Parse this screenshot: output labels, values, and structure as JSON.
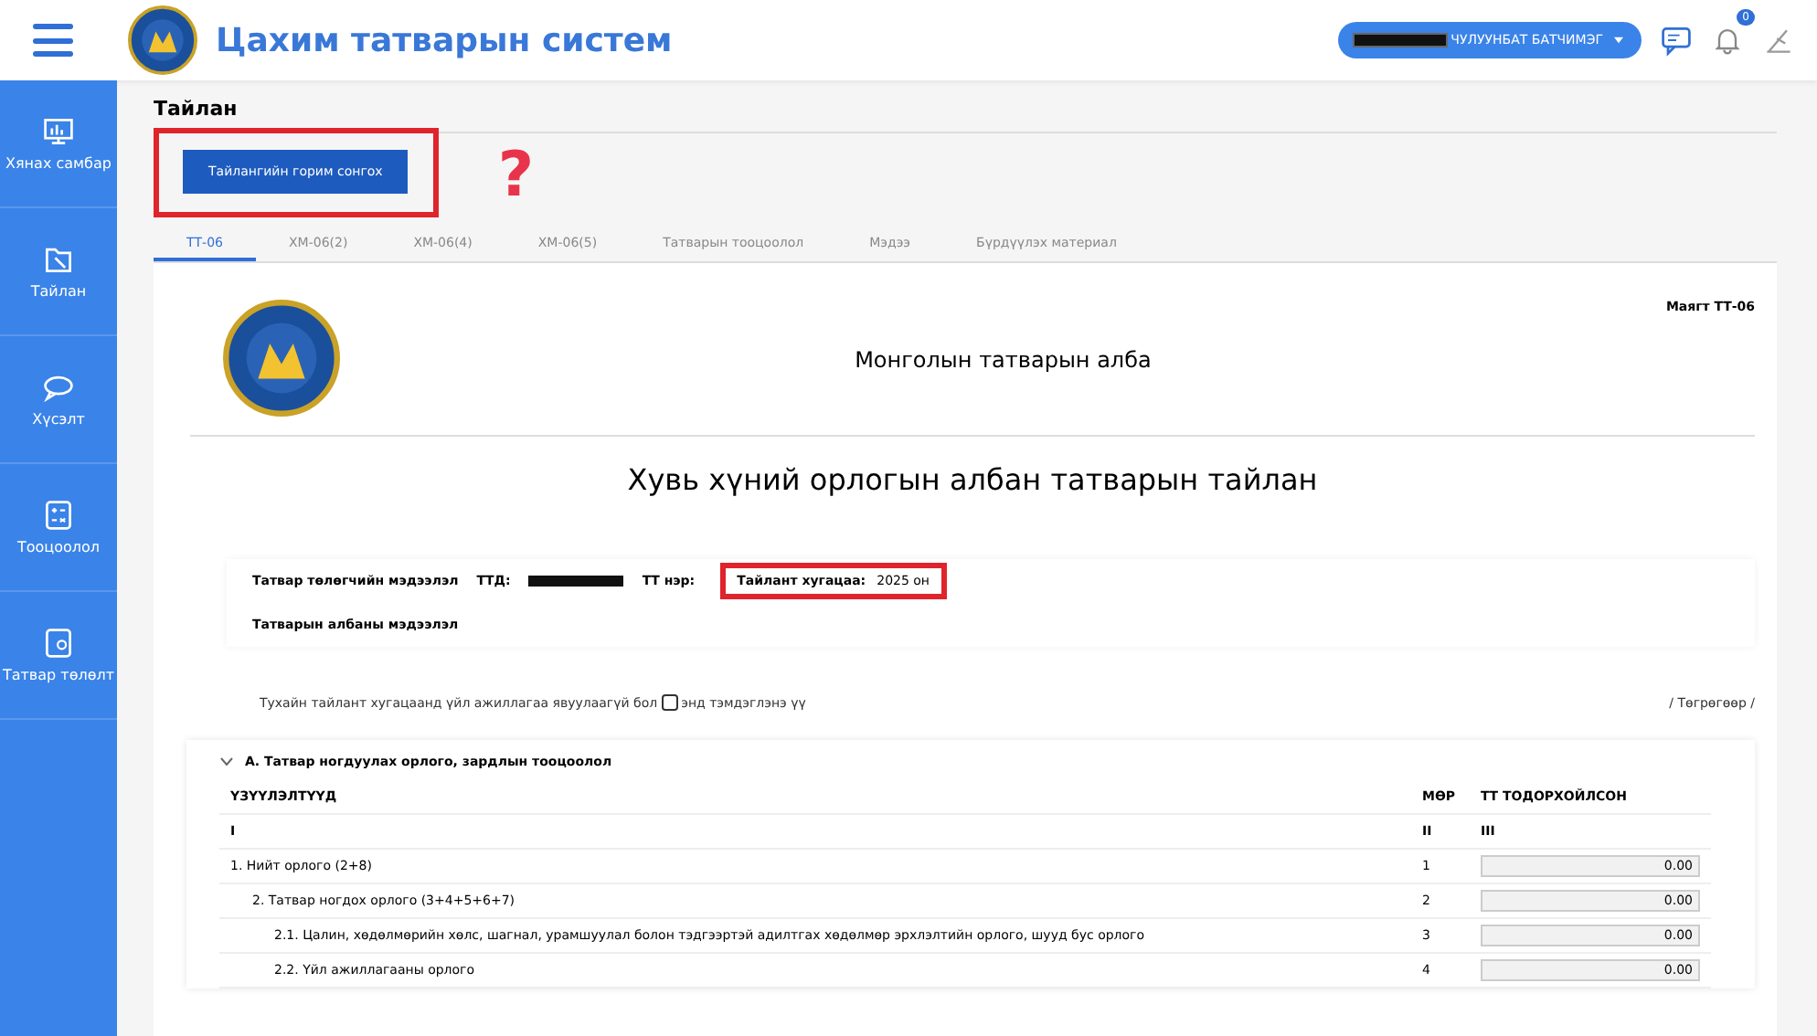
{
  "header": {
    "title": "Цахим татварын систем",
    "user": "ЧУЛУУНБАТ БАТЧИМЭГ",
    "notification_count": "0"
  },
  "sidebar": {
    "items": [
      {
        "label": "Хянах самбар",
        "kind": "dashboard"
      },
      {
        "label": "Тайлан",
        "kind": "report"
      },
      {
        "label": "Хүсэлт",
        "kind": "request"
      },
      {
        "label": "Тооцоолол",
        "kind": "calculator"
      },
      {
        "label": "Татвар төлөлт",
        "kind": "payment"
      }
    ]
  },
  "breadcrumb": "Тайлан",
  "mode_button": "Тайлангийн горим сонгох",
  "annotation_mark": "?",
  "tabs": [
    {
      "label": "ТТ-06",
      "selected": true
    },
    {
      "label": "ХМ-06(2)",
      "selected": false
    },
    {
      "label": "ХМ-06(4)",
      "selected": false
    },
    {
      "label": "ХМ-06(5)",
      "selected": false
    },
    {
      "label": "Татварын тооцоолол",
      "selected": false
    },
    {
      "label": "Мэдээ",
      "selected": false
    },
    {
      "label": "Бүрдүүлэх материал",
      "selected": false
    }
  ],
  "form": {
    "code": "Маягт ТТ-06",
    "agency": "Монголын татварын алба",
    "title": "Хувь хүний орлогын албан татварын тайлан",
    "taxpayer_label": "Татвар төлөгчийн мэдээлэл",
    "ttd_label": "ТТД:",
    "name_label": "ТТ нэр:",
    "period_label": "Тайлант хугацаа:",
    "period_value": "2025 он",
    "office_label": "Татварын албаны мэдээлэл",
    "no_activity_before": "Тухайн тайлант хугацаанд үйл ажиллагаа явуулаагүй бол",
    "no_activity_checked": false,
    "no_activity_after": "энд тэмдэглэнэ үү",
    "currency": "/ Төгрөгөөр /"
  },
  "section": {
    "title": "А. Татвар ногдуулах орлого, зардлын тооцоолол",
    "expanded": true,
    "columns": [
      "ҮЗҮҮЛЭЛТҮҮД",
      "МӨР",
      "ТТ ТОДОРХОЙЛСОН"
    ],
    "roman": [
      "I",
      "II",
      "III"
    ],
    "rows": [
      {
        "label": "1. Нийт орлого (2+8)",
        "line": "1",
        "value": "0.00",
        "children": [
          {
            "label": "2. Татвар ногдох орлого (3+4+5+6+7)",
            "line": "2",
            "value": "0.00",
            "children": [
              {
                "label": "2.1. Цалин, хөдөлмөрийн хөлс, шагнал, урамшуулал болон тэдгээртэй адилтгах хөдөлмөр эрхлэлтийн орлого, шууд бус орлого",
                "line": "3",
                "value": "0.00"
              },
              {
                "label": "2.2. Үйл ажиллагааны орлого",
                "line": "4",
                "value": "0.00"
              }
            ]
          }
        ]
      }
    ]
  }
}
